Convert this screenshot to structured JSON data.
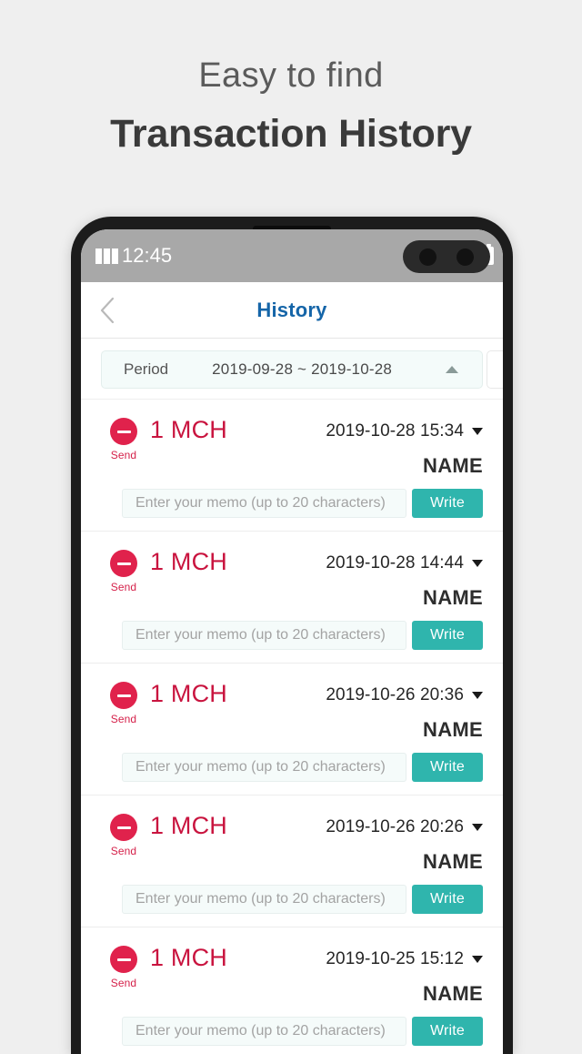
{
  "promo": {
    "line1": "Easy to find",
    "line2": "Transaction History"
  },
  "status_bar": {
    "time": "12:45",
    "battery_percent": "100%",
    "signal_icon": "signal-bars-icon",
    "wifi_icon": "signal-triangle-icon",
    "battery_icon": "battery-full-icon"
  },
  "app_bar": {
    "title": "History",
    "back_icon": "chevron-left-icon"
  },
  "period": {
    "label": "Period",
    "range": "2019-09-28 ~ 2019-10-28",
    "caret_icon": "caret-up-icon"
  },
  "memo": {
    "placeholder": "Enter your memo (up to 20 characters)",
    "value": "",
    "write_label": "Write"
  },
  "colors": {
    "accent_red": "#e0224c",
    "amount_red": "#c9143f",
    "teal": "#2fb5ad",
    "title_blue": "#1565a8",
    "statusbar_gray": "#a8a8a8"
  },
  "transactions": [
    {
      "kind": "Send",
      "amount": "1 MCH",
      "datetime": "2019-10-28 15:34",
      "name": "NAME"
    },
    {
      "kind": "Send",
      "amount": "1 MCH",
      "datetime": "2019-10-28 14:44",
      "name": "NAME"
    },
    {
      "kind": "Send",
      "amount": "1 MCH",
      "datetime": "2019-10-26 20:36",
      "name": "NAME"
    },
    {
      "kind": "Send",
      "amount": "1 MCH",
      "datetime": "2019-10-26 20:26",
      "name": "NAME"
    },
    {
      "kind": "Send",
      "amount": "1 MCH",
      "datetime": "2019-10-25 15:12",
      "name": "NAME"
    }
  ]
}
